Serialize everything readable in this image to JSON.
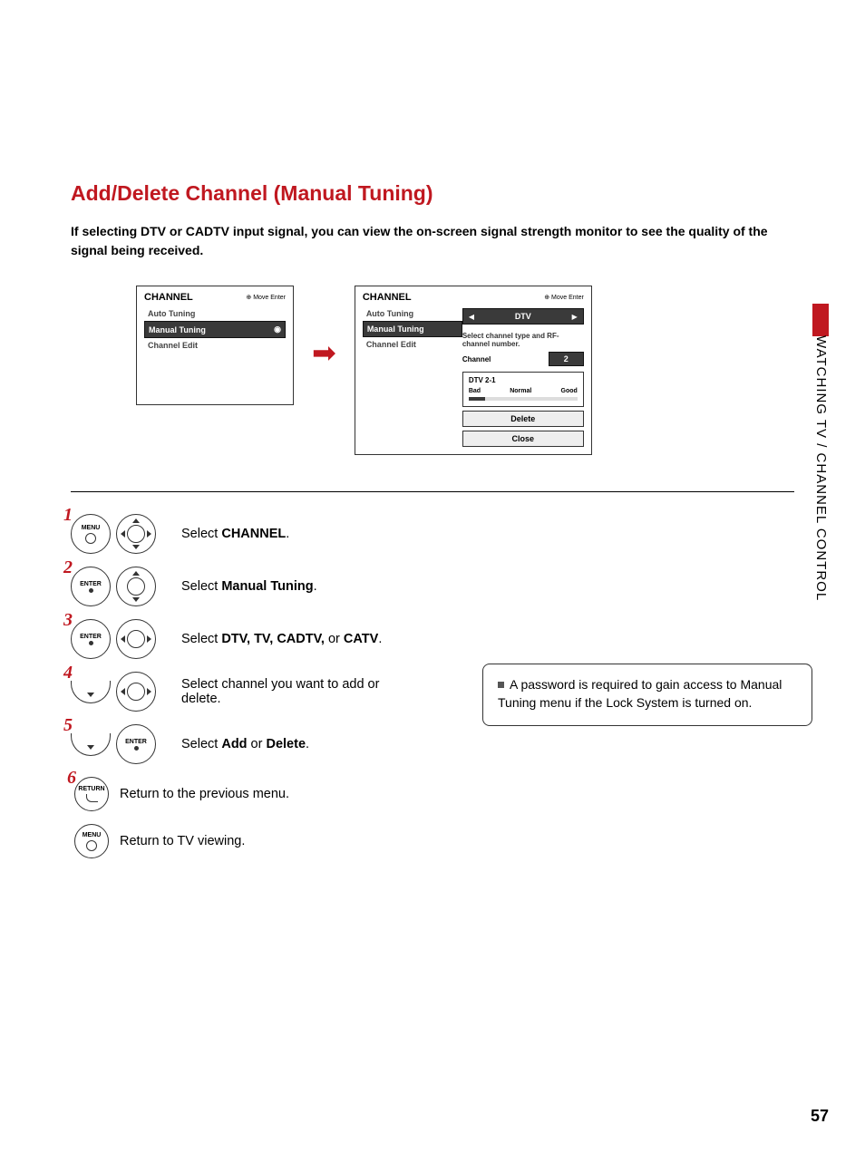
{
  "title": "Add/Delete Channel (Manual Tuning)",
  "intro": "If selecting DTV or CADTV input signal, you can view the on-screen signal strength monitor to see the quality of the signal being received.",
  "side_section": "WATCHING TV / CHANNEL CONTROL",
  "page_number": "57",
  "osd1": {
    "header": "CHANNEL",
    "hints": "Move     Enter",
    "items": [
      "Auto Tuning",
      "Manual Tuning",
      "Channel Edit"
    ],
    "selected": "Manual Tuning"
  },
  "osd2": {
    "header": "CHANNEL",
    "hints": "Move     Enter",
    "left_items": [
      "Auto Tuning",
      "Manual Tuning",
      "Channel Edit"
    ],
    "left_selected": "Manual Tuning",
    "type_value": "DTV",
    "instruction": "Select channel type and RF-channel number.",
    "channel_label": "Channel",
    "channel_value": "2",
    "current": "DTV 2-1",
    "signal": {
      "bad": "Bad",
      "normal": "Normal",
      "good": "Good"
    },
    "btn_delete": "Delete",
    "btn_close": "Close"
  },
  "steps": {
    "s1": {
      "num": "1",
      "btn": "MENU",
      "text_pre": "Select ",
      "text_bold": "CHANNEL",
      "text_post": "."
    },
    "s2": {
      "num": "2",
      "btn": "ENTER",
      "text_pre": "Select ",
      "text_bold": "Manual Tuning",
      "text_post": "."
    },
    "s3": {
      "num": "3",
      "btn": "ENTER",
      "text_pre": "Select ",
      "text_bold": "DTV, TV, CADTV,",
      "text_mid": " or ",
      "text_bold2": "CATV",
      "text_post": "."
    },
    "s4": {
      "num": "4",
      "text": "Select channel you want to add or delete."
    },
    "s5": {
      "num": "5",
      "btn": "ENTER",
      "text_pre": "Select ",
      "text_bold": "Add",
      "text_mid": " or ",
      "text_bold2": "Delete",
      "text_post": "."
    },
    "s6": {
      "num": "6",
      "btn": "RETURN",
      "text": "Return to the previous menu."
    },
    "s7": {
      "btn": "MENU",
      "text": "Return to TV viewing."
    }
  },
  "note": "A password is required to gain access to Manual Tuning menu if the Lock System is turned on."
}
